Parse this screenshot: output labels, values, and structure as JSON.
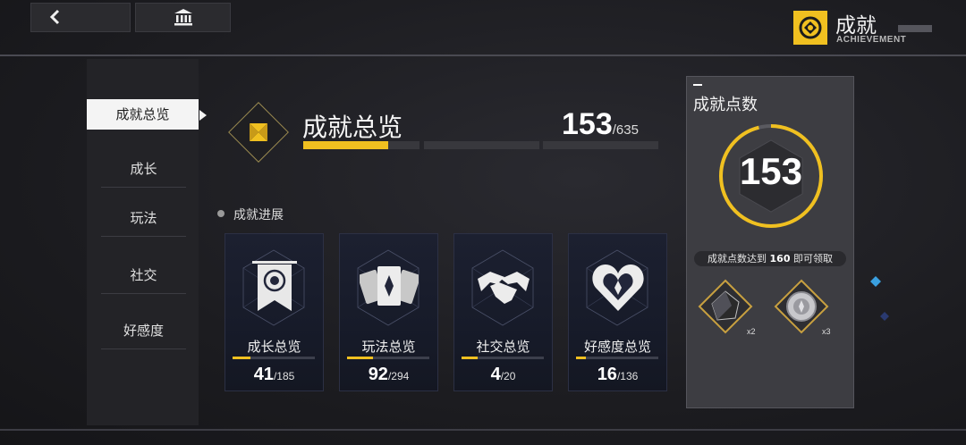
{
  "header": {
    "title": "成就",
    "subtitle": "ACHIEVEMENT"
  },
  "sidebar": {
    "items": [
      {
        "label": "成就总览",
        "active": true
      },
      {
        "label": "成长"
      },
      {
        "label": "玩法"
      },
      {
        "label": "社交"
      },
      {
        "label": "好感度"
      }
    ]
  },
  "overview": {
    "title": "成就总览",
    "count": "153",
    "total": "/635",
    "progress": 0.24
  },
  "progress_section": {
    "label": "成就进展"
  },
  "cards": [
    {
      "label": "成长总览",
      "count": "41",
      "total": "/185",
      "progress": 0.22,
      "icon": "banner-icon"
    },
    {
      "label": "玩法总览",
      "count": "92",
      "total": "/294",
      "progress": 0.31,
      "icon": "cards-icon"
    },
    {
      "label": "社交总览",
      "count": "4",
      "total": "/20",
      "progress": 0.2,
      "icon": "handshake-icon"
    },
    {
      "label": "好感度总览",
      "count": "16",
      "total": "/136",
      "progress": 0.12,
      "icon": "heart-icon"
    }
  ],
  "points_panel": {
    "title": "成就点数",
    "points": "153",
    "progress": 0.96,
    "reward_text_pre": "成就点数达到",
    "reward_threshold": "160",
    "reward_text_post": "即可领取",
    "rewards": [
      {
        "icon": "crystal-icon",
        "qty": "x2"
      },
      {
        "icon": "silver-coin-icon",
        "qty": "x3"
      }
    ]
  },
  "colors": {
    "accent": "#f0c020",
    "background": "#1c1c20",
    "panel": "#3d3d42"
  }
}
